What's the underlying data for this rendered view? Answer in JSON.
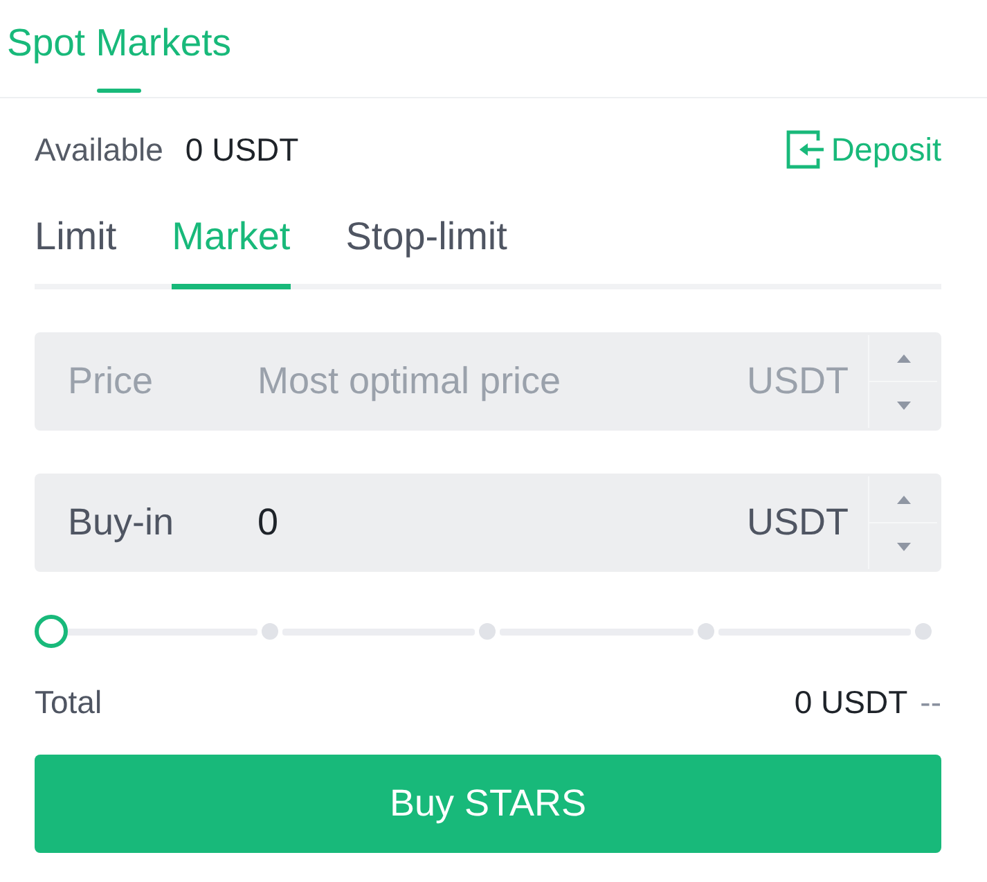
{
  "header": {
    "tabs": [
      {
        "label": "Spot Markets",
        "selected": true
      }
    ]
  },
  "available": {
    "label": "Available",
    "value": "0 USDT",
    "deposit": "Deposit"
  },
  "order_tabs": [
    {
      "label": "Limit",
      "selected": false
    },
    {
      "label": "Market",
      "selected": true
    },
    {
      "label": "Stop-limit",
      "selected": false
    }
  ],
  "fields": [
    {
      "label": "Price",
      "placeholder": "Most optimal price",
      "unit": "USDT",
      "disabled": true
    },
    {
      "label": "Buy-in",
      "value": "0",
      "unit": "USDT",
      "disabled": false
    }
  ],
  "slider": {
    "level": 0
  },
  "total": {
    "label": "Total",
    "value": "0 USDT",
    "converted": "--"
  },
  "submit": {
    "label": "Buy STARS"
  }
}
